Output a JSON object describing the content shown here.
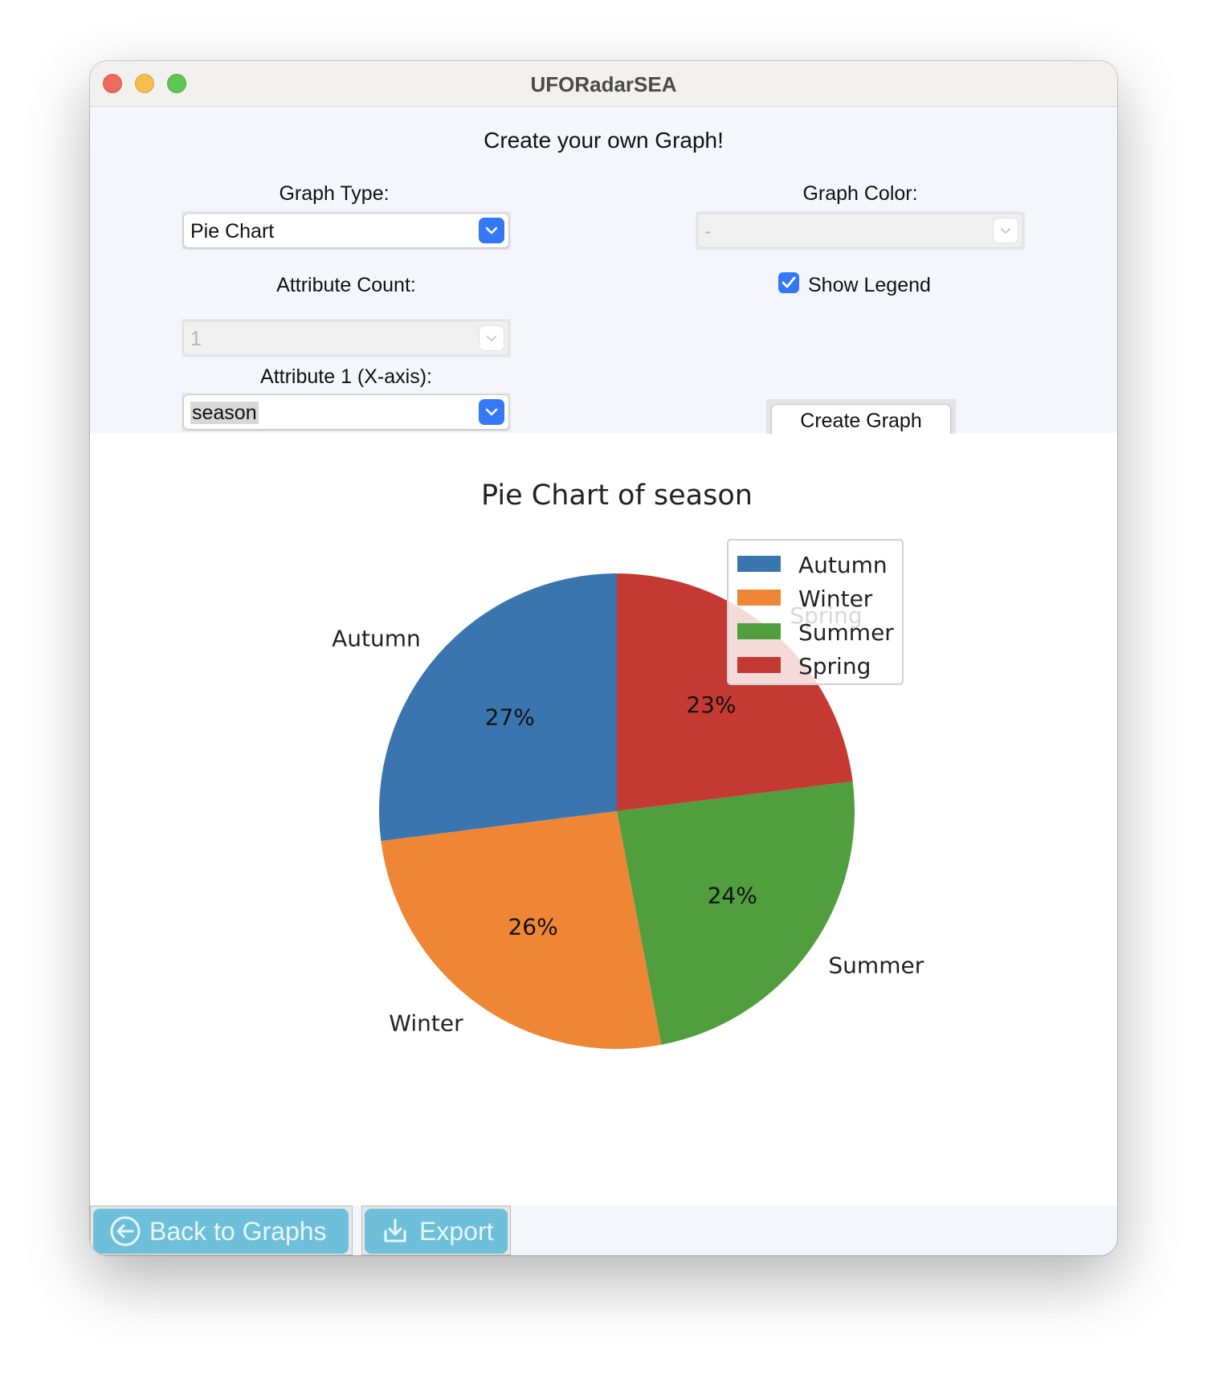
{
  "window": {
    "title": "UFORadarSEA"
  },
  "controls": {
    "heading": "Create your own Graph!",
    "graph_type_label": "Graph Type:",
    "graph_type_value": "Pie Chart",
    "graph_color_label": "Graph Color:",
    "graph_color_value": "-",
    "attribute_count_label": "Attribute Count:",
    "attribute_count_value": "1",
    "show_legend_label": "Show Legend",
    "show_legend_checked": true,
    "attribute1_label": "Attribute 1 (X-axis):",
    "attribute1_value": "season",
    "create_button": "Create Graph"
  },
  "bottom": {
    "back_button": "Back to Graphs",
    "export_button": "Export"
  },
  "chart_data": {
    "type": "pie",
    "title": "Pie Chart of season",
    "categories": [
      "Autumn",
      "Winter",
      "Summer",
      "Spring"
    ],
    "values": [
      27,
      26,
      24,
      23
    ],
    "value_labels": [
      "27%",
      "26%",
      "24%",
      "23%"
    ],
    "colors": [
      "#3b75af",
      "#ee8636",
      "#519e3e",
      "#c43a32"
    ],
    "legend": {
      "entries": [
        "Autumn",
        "Winter",
        "Summer",
        "Spring"
      ],
      "placement": "top-right"
    },
    "start_angle_deg": 90,
    "direction": "counterclockwise"
  }
}
